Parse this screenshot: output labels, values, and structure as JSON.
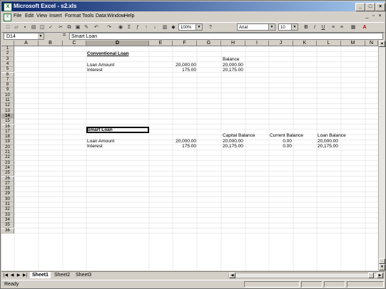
{
  "window": {
    "title": "Microsoft Excel - s2.xls",
    "app_icon": "X"
  },
  "menu": [
    "File",
    "Edit",
    "View",
    "Insert",
    "Format",
    "Tools",
    "Data",
    "Window",
    "Help"
  ],
  "toolbar": {
    "zoom": "100%",
    "font": "Arial",
    "size": "10"
  },
  "formula_bar": {
    "name_box": "D14",
    "content": "Smart Loan"
  },
  "columns": [
    "A",
    "B",
    "C",
    "D",
    "E",
    "F",
    "G",
    "H",
    "I",
    "J",
    "K",
    "L",
    "M",
    "N"
  ],
  "rows": [
    "1",
    "2",
    "3",
    "4",
    "5",
    "6",
    "7",
    "8",
    "9",
    "10",
    "11",
    "12",
    "13",
    "14",
    "15",
    "16",
    "17",
    "18",
    "19",
    "20",
    "21",
    "22",
    "23",
    "24",
    "25",
    "26",
    "27",
    "28",
    "29",
    "30",
    "31",
    "32",
    "33",
    "34",
    "35",
    "36"
  ],
  "cells": {
    "d2": "Conventional Loan",
    "h3": "Balance",
    "d4": "Loan Amount",
    "f4": "20,000.00",
    "h4": "20,000.00",
    "d5": "Interest",
    "f5": "175.00",
    "h5": "20,175.00",
    "d14": "Smart Loan",
    "h15": "Capital Balance",
    "j15": "Current Balance",
    "l15": "Loan Balance",
    "d16": "Loan Amount",
    "f16": "20,000.00",
    "h16": "20,000.00",
    "j16": "0.00",
    "l16": "20,000.00",
    "d17": "Interest",
    "f17": "175.00",
    "h17": "20,175.00",
    "j17": "0.00",
    "l17": "20,175.00"
  },
  "sheets": [
    "Sheet1",
    "Sheet2",
    "Sheet3"
  ],
  "status": "Ready"
}
